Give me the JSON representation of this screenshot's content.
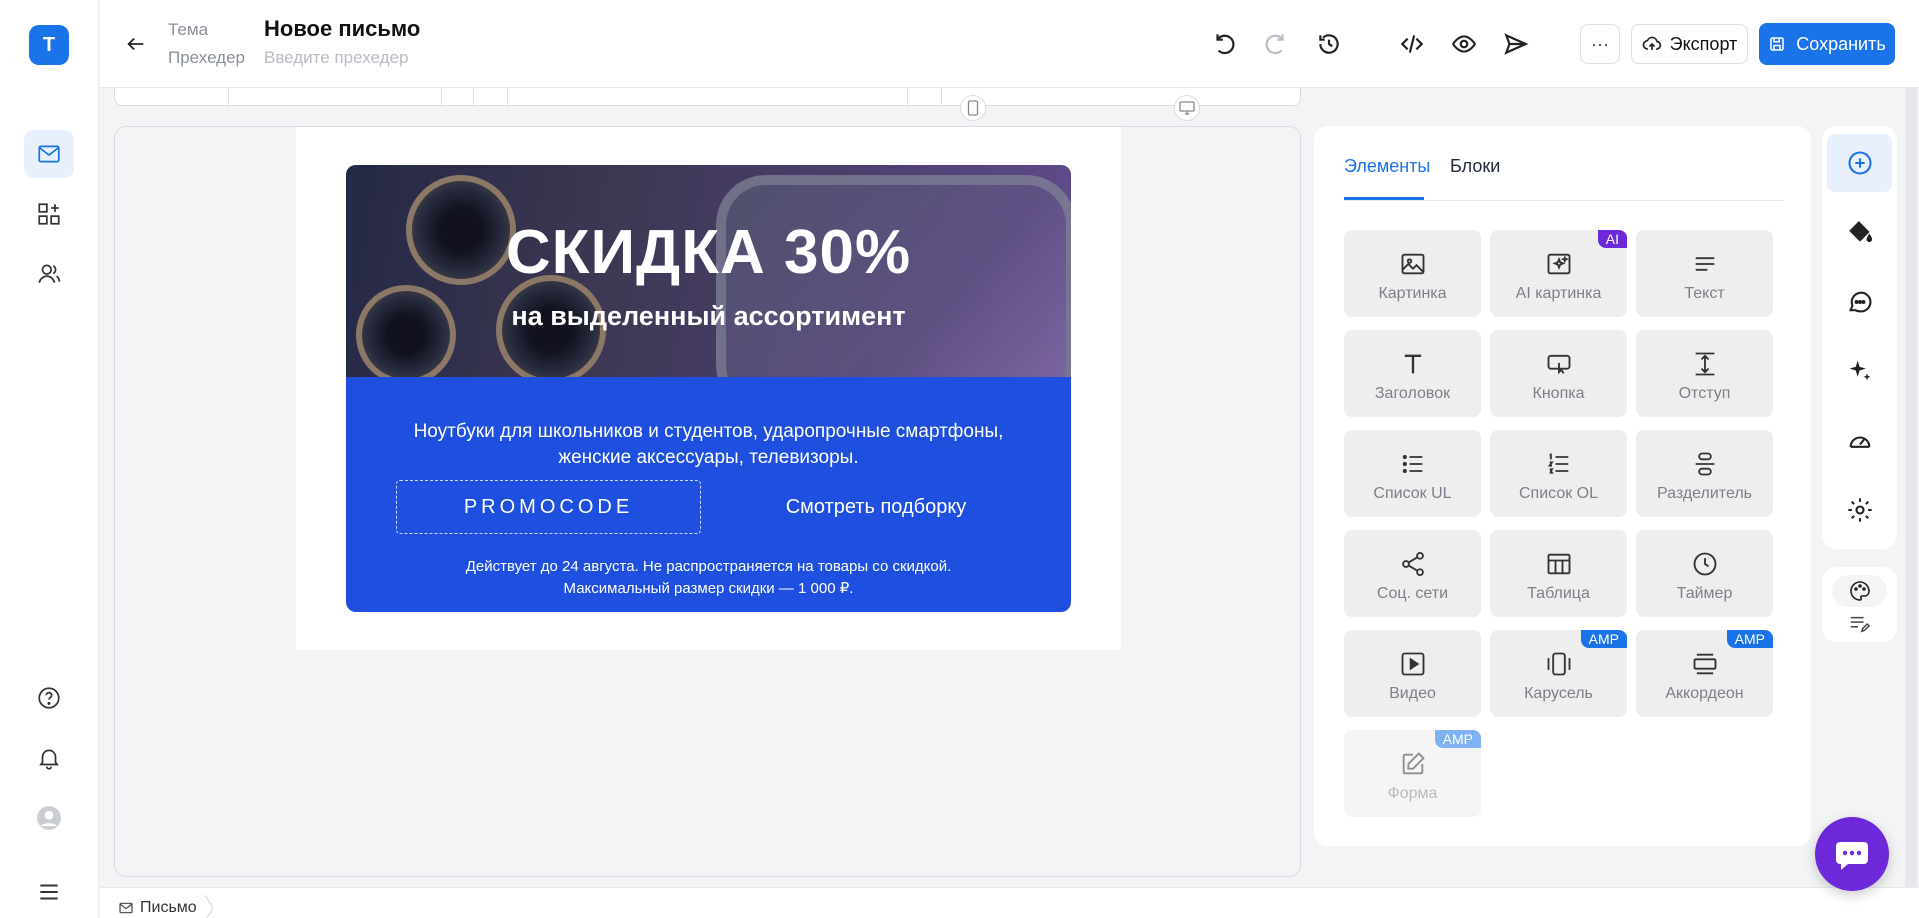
{
  "app": {
    "logo_letter": "T"
  },
  "header": {
    "theme_label": "Тема",
    "title": "Новое письмо",
    "preheader_label": "Прехедер",
    "preheader_placeholder": "Введите прехедер",
    "more_label": "···",
    "export_label": "Экспорт",
    "save_label": "Сохранить"
  },
  "email": {
    "headline": "СКИДКА 30%",
    "subheadline": "на выделенный ассортимент",
    "description_line1": "Ноутбуки для школьников и студентов, ударопрочные смартфоны,",
    "description_line2": "женские аксессуары, телевизоры.",
    "promocode": "PROMOCODE",
    "cta": "Смотреть подборку",
    "fine_line1": "Действует до 24 августа. Не распространяется на товары со скидкой.",
    "fine_line2": "Максимальный размер скидки — 1 000 ₽."
  },
  "panel": {
    "tabs": [
      "Элементы",
      "Блоки"
    ],
    "elements": [
      {
        "label": "Картинка",
        "icon": "image-icon"
      },
      {
        "label": "AI картинка",
        "icon": "ai-image-icon",
        "badge": "AI"
      },
      {
        "label": "Текст",
        "icon": "text-icon"
      },
      {
        "label": "Заголовок",
        "icon": "heading-icon"
      },
      {
        "label": "Кнопка",
        "icon": "button-icon"
      },
      {
        "label": "Отступ",
        "icon": "spacer-icon"
      },
      {
        "label": "Список UL",
        "icon": "list-ul-icon"
      },
      {
        "label": "Список OL",
        "icon": "list-ol-icon"
      },
      {
        "label": "Разделитель",
        "icon": "divider-icon"
      },
      {
        "label": "Соц. сети",
        "icon": "share-icon"
      },
      {
        "label": "Таблица",
        "icon": "table-icon"
      },
      {
        "label": "Таймер",
        "icon": "clock-icon"
      },
      {
        "label": "Видео",
        "icon": "video-icon"
      },
      {
        "label": "Карусель",
        "icon": "carousel-icon",
        "badge": "AMP"
      },
      {
        "label": "Аккордеон",
        "icon": "accordion-icon",
        "badge": "AMP"
      },
      {
        "label": "Форма",
        "icon": "form-icon",
        "badge": "AMP"
      }
    ]
  },
  "footer": {
    "breadcrumb": "Письмо"
  },
  "colors": {
    "accent": "#1a73e8",
    "banner_blue": "#1f4fdf",
    "ai_badge": "#6d28d9",
    "chat": "#6d28d9"
  }
}
